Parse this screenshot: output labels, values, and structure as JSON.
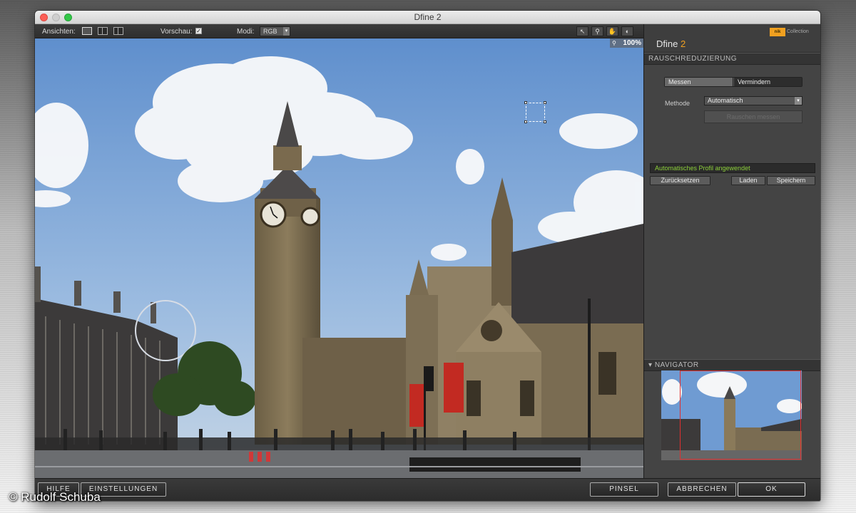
{
  "window": {
    "title": "Dfine 2"
  },
  "toolbar": {
    "views_label": "Ansichten:",
    "preview_label": "Vorschau:",
    "preview_checked": true,
    "mode_label": "Modi:",
    "mode_value": "RGB",
    "zoom": "100%"
  },
  "panel": {
    "brand_name": "Dfine",
    "brand_version": "2",
    "nik_logo": "nik",
    "nik_collection": "Collection",
    "section_noise": "RAUSCHREDUZIERUNG",
    "seg_measure": "Messen",
    "seg_reduce": "Vermindern",
    "method_label": "Methode",
    "method_value": "Automatisch",
    "measure_button": "Rauschen messen",
    "status": "Automatisches Profil angewendet",
    "reset_button": "Zurücksetzen",
    "load_button": "Laden",
    "save_button": "Speichern",
    "section_navigator": "NAVIGATOR"
  },
  "bottom": {
    "help": "HILFE",
    "settings": "EINSTELLUNGEN",
    "brush": "PINSEL",
    "cancel": "ABBRECHEN",
    "ok": "OK"
  },
  "copyright": "© Rudolf Schuba",
  "colors": {
    "accent": "#f0a020",
    "status_green": "#8dd13a",
    "navigator_frame": "#e03030"
  }
}
